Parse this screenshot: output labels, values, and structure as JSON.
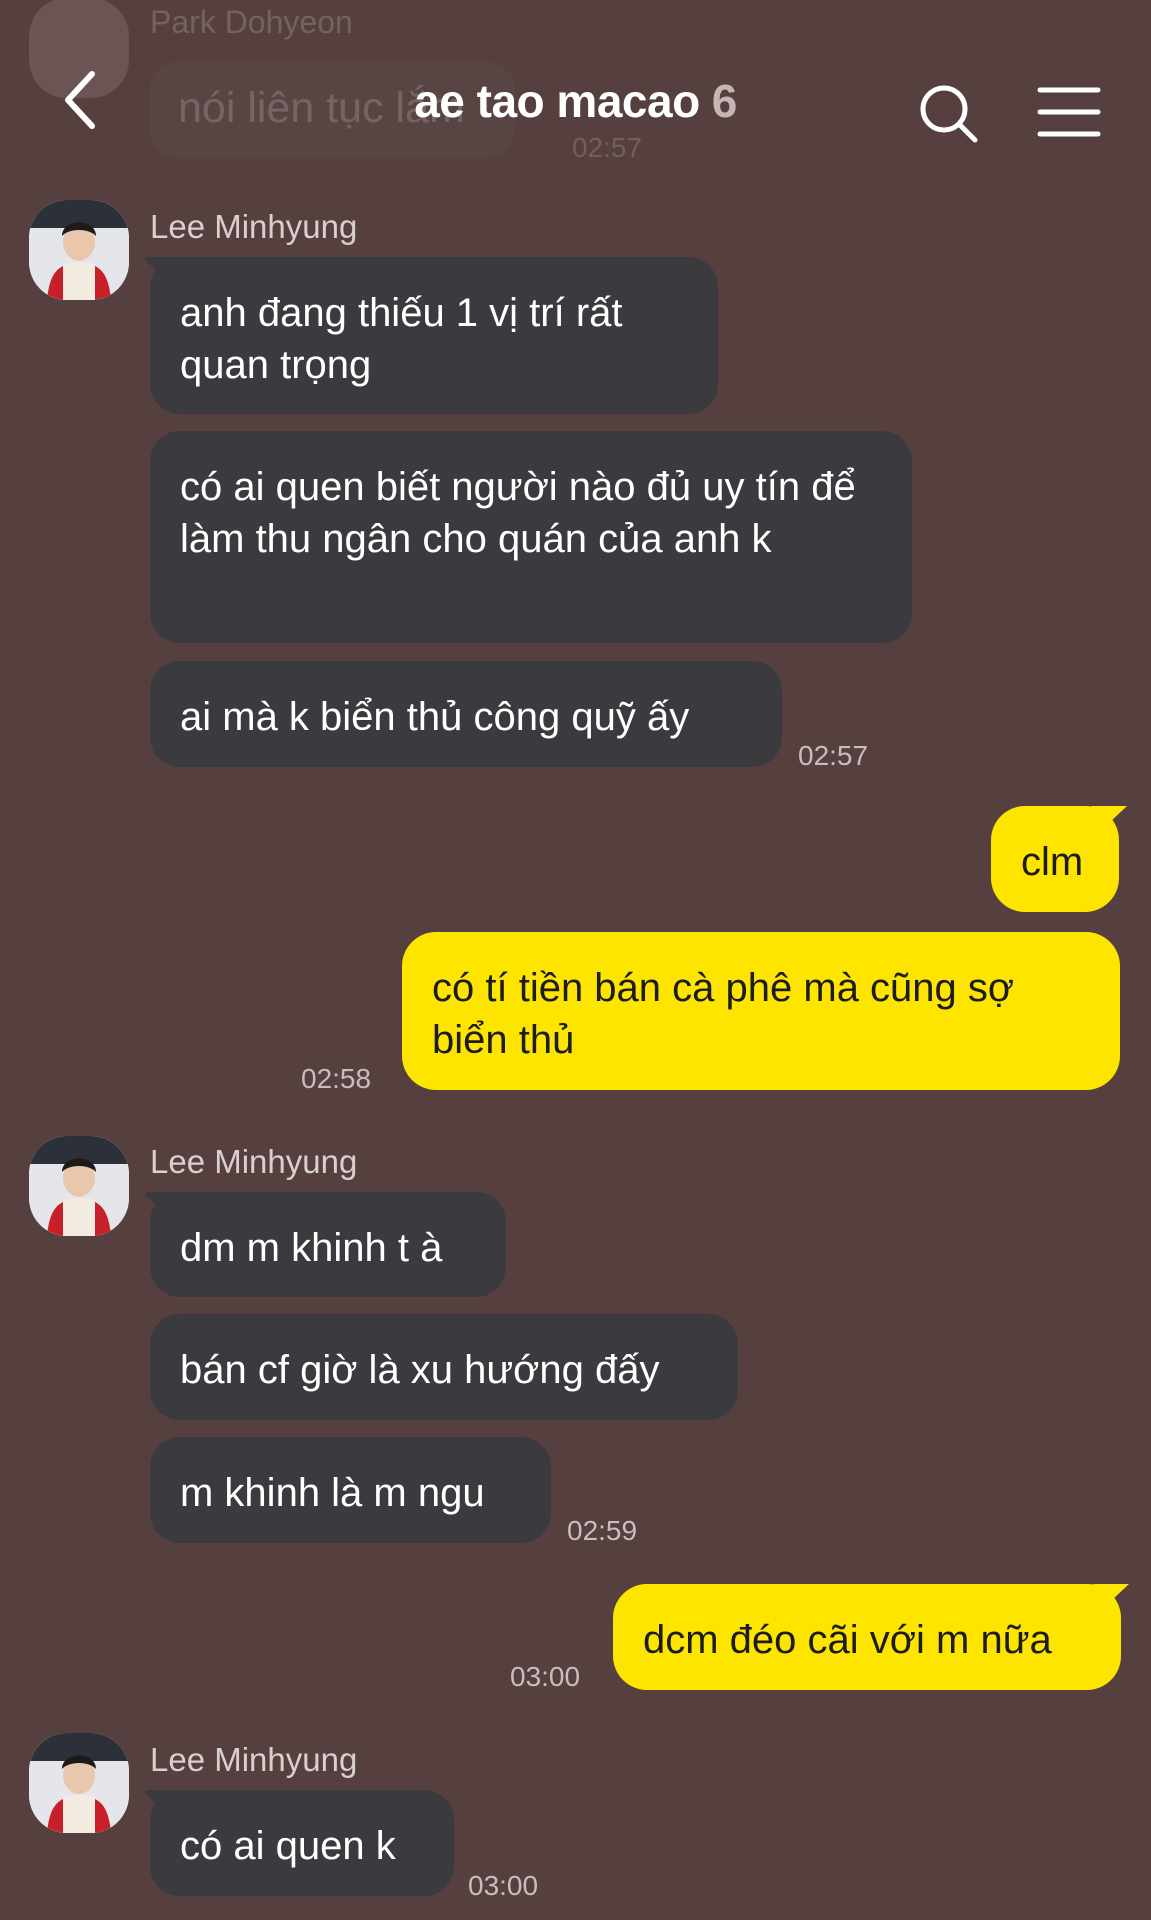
{
  "header": {
    "title": "ae tao macao",
    "member_count": "6",
    "back_icon": "chevron-left-icon",
    "search_icon": "search-icon",
    "menu_icon": "hamburger-menu-icon"
  },
  "previous": {
    "sender": "Park Dohyeon",
    "text": "nói liên tục lắm",
    "time": "02:57"
  },
  "messages": {
    "g1": {
      "sender": "Lee Minhyung",
      "m1": "anh đang thiếu 1 vị trí rất quan trọng",
      "m2": "có ai quen biết người nào đủ uy tín để làm thu ngân cho quán của anh k",
      "m3": "ai mà k biển thủ công quỹ ấy",
      "time": "02:57"
    },
    "g2": {
      "m1": "clm",
      "m2": "có tí tiền bán cà phê mà cũng sợ biển thủ",
      "time": "02:58"
    },
    "g3": {
      "sender": "Lee Minhyung",
      "m1": "dm m khinh t à",
      "m2": "bán cf giờ là xu hướng đấy",
      "m3": "m khinh là m ngu",
      "time": "02:59"
    },
    "g4": {
      "m1": "dcm đéo cãi với m nữa",
      "time": "03:00"
    },
    "g5": {
      "sender": "Lee Minhyung",
      "m1": "có ai quen k",
      "time": "03:00"
    }
  },
  "colors": {
    "background": "#553f3f",
    "incoming_bubble": "#3b3a3e",
    "outgoing_bubble": "#fde500"
  }
}
